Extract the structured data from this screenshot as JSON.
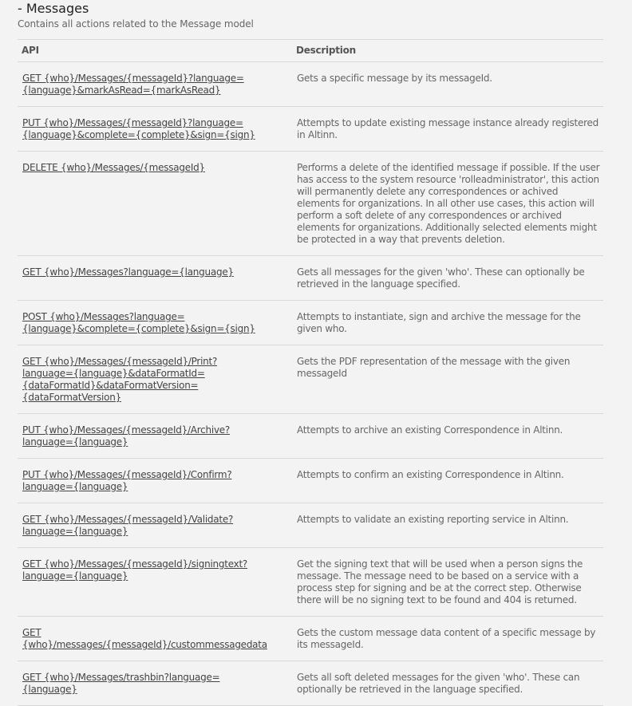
{
  "section": {
    "title": "- Messages",
    "subtitle": "Contains all actions related to the Message model"
  },
  "table": {
    "headers": [
      "API",
      "Description"
    ],
    "rows": [
      {
        "api": "GET {who}/Messages/{messageId}?language=\n{language}&markAsRead={markAsRead}",
        "description": "Gets a specific message by its messageId."
      },
      {
        "api": "PUT {who}/Messages/{messageId}?language=\n{language}&complete={complete}&sign={sign}",
        "description": "Attempts to update existing message instance already registered in Altinn."
      },
      {
        "api": "DELETE {who}/Messages/{messageId}",
        "description": "Performs a delete of the identified message if possible. If the user has access to the system resource 'rolleadministrator', this action will permanently delete any correspondences or achived elements for organizations. In all other use cases, this action will perform a soft delete of any correspondences or archived elements for organizations. Additionally selected elements might be protected in a way that prevents deletion."
      },
      {
        "api": "GET {who}/Messages?language={language}",
        "description": "Gets all messages for the given 'who'. These can optionally be retrieved in the language specified."
      },
      {
        "api": "POST {who}/Messages?language=\n{language}&complete={complete}&sign={sign}",
        "description": "Attempts to instantiate, sign and archive the message for the given who."
      },
      {
        "api": "GET {who}/Messages/{messageId}/Print?\nlanguage={language}&dataFormatId=\n{dataFormatId}&dataFormatVersion=\n{dataFormatVersion}",
        "description": "Gets the PDF representation of the message with the given messageId"
      },
      {
        "api": "PUT {who}/Messages/{messageId}/Archive?\nlanguage={language}",
        "description": "Attempts to archive an existing Correspondence in Altinn."
      },
      {
        "api": "PUT {who}/Messages/{messageId}/Confirm?\nlanguage={language}",
        "description": "Attempts to confirm an existing Correspondence in Altinn."
      },
      {
        "api": "GET {who}/Messages/{messageId}/Validate?\nlanguage={language}",
        "description": "Attempts to validate an existing reporting service in Altinn."
      },
      {
        "api": "GET {who}/Messages/{messageId}/signingtext?\nlanguage={language}",
        "description": "Get the signing text that will be used when a person signs the message. The message need to be based on a service with a process step for signing and be at the correct step. Otherwise there will be no signing text to be found and 404 is returned."
      },
      {
        "api": "GET\n{who}/messages/{messageId}/custommessagedata",
        "description": "Gets the custom message data content of a specific message by its messageId."
      },
      {
        "api": "GET {who}/Messages/trashbin?language=\n{language}",
        "description": "Gets all soft deleted messages for the given 'who'. These can optionally be retrieved in the language specified."
      }
    ]
  }
}
